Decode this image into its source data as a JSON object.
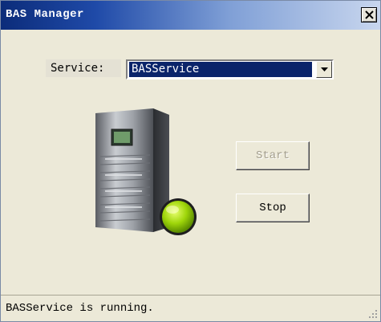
{
  "window": {
    "title": "BAS Manager"
  },
  "service": {
    "label": "Service:",
    "selected": "BASService"
  },
  "buttons": {
    "start": "Start",
    "stop": "Stop"
  },
  "status": {
    "text": "BASService is running.",
    "indicator_color": "#8ed000"
  },
  "icons": {
    "close": "close-icon",
    "dropdown": "chevron-down-icon",
    "server": "server-icon",
    "status_light": "status-light-icon",
    "grip": "resize-grip-icon"
  },
  "colors": {
    "selection": "#0a246a",
    "titlebar": "#0c2c7a",
    "window": "#ece9d8"
  }
}
